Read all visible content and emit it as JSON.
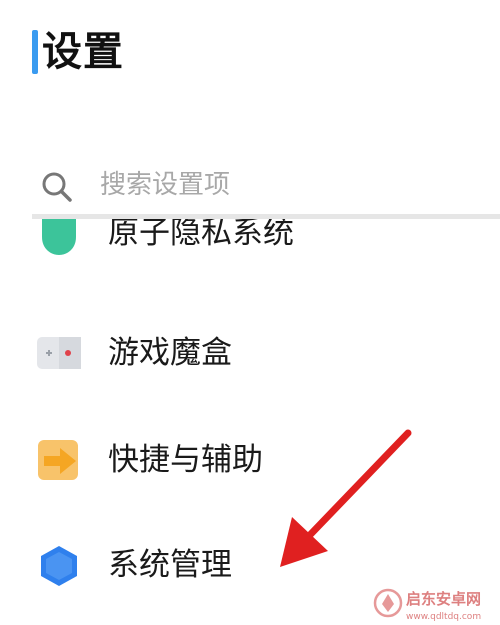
{
  "header": {
    "title": "设置"
  },
  "search": {
    "placeholder": "搜索设置项"
  },
  "settings_list": {
    "items": [
      {
        "label": "原子隐私系统",
        "icon": "privacy-shield-icon"
      },
      {
        "label": "游戏魔盒",
        "icon": "game-box-icon"
      },
      {
        "label": "快捷与辅助",
        "icon": "shortcut-arrow-icon"
      },
      {
        "label": "系统管理",
        "icon": "system-hexagon-icon"
      }
    ]
  },
  "watermark": {
    "brand": "启东安卓网",
    "url": "www.qdltdq.com"
  },
  "colors": {
    "accent": "#3a9bf0",
    "privacy_icon": "#3cc49a",
    "shortcut_icon": "#f5a623",
    "system_icon": "#2f80ed",
    "annotation_arrow": "#e02020"
  }
}
